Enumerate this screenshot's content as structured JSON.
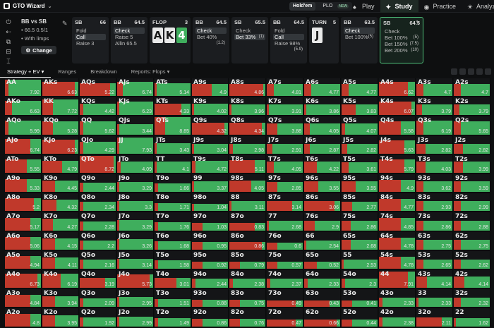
{
  "app": {
    "name": "GTO Wizard"
  },
  "mode_toggle": {
    "holdem": "Hold'em",
    "plo": "PLO",
    "new_badge": "NEW"
  },
  "nav": [
    {
      "label": "Play",
      "icon": "cards-icon"
    },
    {
      "label": "Study",
      "icon": "study-icon",
      "active": true
    },
    {
      "label": "Practice",
      "icon": "gamepad-icon"
    },
    {
      "label": "Analyze",
      "icon": "analyze-icon"
    }
  ],
  "spot": {
    "title": "BB vs SB",
    "stack": "66.5",
    "blinds": "0.5/1",
    "limps": "With limps",
    "change_label": "Change"
  },
  "action_cards": [
    {
      "pos": "SB",
      "stack": "66",
      "actions": [
        {
          "label": "Fold"
        },
        {
          "label": "Call",
          "sel": true
        },
        {
          "label": "Raise 3"
        }
      ]
    },
    {
      "pos": "BB",
      "stack": "64.5",
      "actions": [
        {
          "label": "Check",
          "sel": true
        },
        {
          "label": "Raise 5"
        },
        {
          "label": "Allin 65.5"
        }
      ]
    },
    {
      "pos": "FLOP",
      "stack": "3",
      "board": [
        "A",
        "K",
        "4"
      ]
    },
    {
      "pos": "BB",
      "stack": "64.5",
      "actions": [
        {
          "label": "Check",
          "sel": true
        },
        {
          "label": "Bet 40%",
          "n": "(1.2)"
        }
      ]
    },
    {
      "pos": "SB",
      "stack": "65.5",
      "actions": [
        {
          "label": "Check"
        },
        {
          "label": "Bet 33%",
          "n": "(1)",
          "sel": true
        }
      ]
    },
    {
      "pos": "BB",
      "stack": "64.5",
      "actions": [
        {
          "label": "Fold"
        },
        {
          "label": "Call",
          "sel": true
        },
        {
          "label": "Raise 98%",
          "n": "(5.9)"
        }
      ]
    },
    {
      "pos": "TURN",
      "stack": "5",
      "board": [
        "J"
      ]
    },
    {
      "pos": "BB",
      "stack": "63.5",
      "actions": [
        {
          "label": "Check",
          "sel": true
        },
        {
          "label": "Bet 100%",
          "n": "(5)"
        }
      ]
    },
    {
      "pos": "SB",
      "stack": "64.5",
      "active": true,
      "actions": [
        {
          "label": "Check"
        },
        {
          "label": "Bet 100%",
          "n": "(5)"
        },
        {
          "label": "Bet 150%",
          "n": "(7.5)"
        },
        {
          "label": "Bet 200%",
          "n": "(10)"
        }
      ]
    }
  ],
  "tabs": [
    "Strategy + EV",
    "Ranges",
    "Breakdown",
    "Reports: Flops"
  ],
  "colors": {
    "check": "#3fae5d",
    "bet": "#c0392b",
    "bg": "#141517"
  },
  "grid": [
    [
      [
        "AA",
        "7.92",
        0.1,
        0.9
      ],
      [
        "AKs",
        "6.63",
        0.9,
        0.1
      ],
      [
        "AQs",
        "5.22",
        0.85,
        0.15
      ],
      [
        "AJs",
        "6.74",
        0.15,
        0.85
      ],
      [
        "ATs",
        "5.14",
        0.05,
        0.95
      ],
      [
        "A9s",
        "4.9",
        0.55,
        0.45
      ],
      [
        "A8s",
        "4.86",
        0.95,
        0.05
      ],
      [
        "A7s",
        "4.81",
        0.2,
        0.8
      ],
      [
        "A6s",
        "4.77",
        0.2,
        0.8
      ],
      [
        "A5s",
        "4.77",
        0.2,
        0.8
      ],
      [
        "A4s",
        "6.62",
        0.8,
        0.2
      ],
      [
        "A3s",
        "4.7",
        0.2,
        0.8
      ],
      [
        "A2s",
        "4.7",
        0.2,
        0.8
      ]
    ],
    [
      [
        "AKo",
        "6.63",
        0.2,
        0.8
      ],
      [
        "KK",
        "7.72",
        0.3,
        0.7
      ],
      [
        "KQs",
        "4.42",
        0.1,
        0.9
      ],
      [
        "KJs",
        "6.23",
        0.05,
        0.95
      ],
      [
        "KTs",
        "4.33",
        0.75,
        0.25
      ],
      [
        "K9s",
        "4.02",
        0.05,
        0.95
      ],
      [
        "K8s",
        "3.96",
        0.05,
        0.95
      ],
      [
        "K7s",
        "3.91",
        0.05,
        0.95
      ],
      [
        "K6s",
        "3.86",
        0.05,
        0.95
      ],
      [
        "K5s",
        "3.83",
        0.4,
        0.6
      ],
      [
        "K4s",
        "6.07",
        0.9,
        0.1
      ],
      [
        "K3s",
        "3.79",
        0.15,
        0.85
      ],
      [
        "K2s",
        "3.79",
        0.15,
        0.85
      ]
    ],
    [
      [
        "AQo",
        "5.99",
        0.1,
        0.9
      ],
      [
        "KQo",
        "5.28",
        0.3,
        0.7
      ],
      [
        "QQ",
        "5.62",
        0.1,
        0.9
      ],
      [
        "QJs",
        "3.44",
        0.05,
        0.95
      ],
      [
        "QTs",
        "8.85",
        0.3,
        0.7
      ],
      [
        "Q9s",
        "4.32",
        0.9,
        0.1
      ],
      [
        "Q8s",
        "4.34",
        0.9,
        0.1
      ],
      [
        "Q7s",
        "3.88",
        0.3,
        0.7
      ],
      [
        "Q6s",
        "4.05",
        0.15,
        0.85
      ],
      [
        "Q5s",
        "4.07",
        0.1,
        0.9
      ],
      [
        "Q4s",
        "5.58",
        0.6,
        0.4
      ],
      [
        "Q3s",
        "6.19",
        0.2,
        0.8
      ],
      [
        "Q2s",
        "5.65",
        0.2,
        0.8
      ]
    ],
    [
      [
        "AJo",
        "6.74",
        0.7,
        0.3
      ],
      [
        "KJo",
        "6.23",
        0.9,
        0.1
      ],
      [
        "QJo",
        "4.29",
        0.1,
        0.9
      ],
      [
        "JJ",
        "7.93",
        0.05,
        0.95
      ],
      [
        "JTs",
        "3.43",
        0.05,
        0.95
      ],
      [
        "J9s",
        "3.04",
        0.05,
        0.95
      ],
      [
        "J8s",
        "2.98",
        0.1,
        0.9
      ],
      [
        "J7s",
        "2.91",
        0.15,
        0.85
      ],
      [
        "J6s",
        "2.87",
        0.15,
        0.85
      ],
      [
        "J5s",
        "2.82",
        0.15,
        0.85
      ],
      [
        "J4s",
        "5.63",
        0.7,
        0.3
      ],
      [
        "J3s",
        "2.82",
        0.25,
        0.75
      ],
      [
        "J2s",
        "2.82",
        0.25,
        0.75
      ]
    ],
    [
      [
        "ATo",
        "5.55",
        0.6,
        0.4
      ],
      [
        "KTo",
        "4.79",
        0.55,
        0.45
      ],
      [
        "QTo",
        "8.72",
        0.95,
        0.05
      ],
      [
        "JTo",
        "4.09",
        0.1,
        0.9
      ],
      [
        "TT",
        "4.1",
        0.05,
        0.95
      ],
      [
        "T9s",
        "4.72",
        0.1,
        0.9
      ],
      [
        "T8s",
        "5.11",
        0.7,
        0.3
      ],
      [
        "T7s",
        "4.05",
        0.2,
        0.8
      ],
      [
        "T6s",
        "4.22",
        0.35,
        0.65
      ],
      [
        "T5s",
        "3.61",
        0.2,
        0.8
      ],
      [
        "T4s",
        "5.79",
        0.7,
        0.3
      ],
      [
        "T3s",
        "4.03",
        0.25,
        0.75
      ],
      [
        "T2s",
        "3.99",
        0.25,
        0.75
      ]
    ],
    [
      [
        "A9o",
        "5.33",
        0.6,
        0.4
      ],
      [
        "K9o",
        "4.45",
        0.35,
        0.65
      ],
      [
        "Q9o",
        "2.44",
        0.1,
        0.9
      ],
      [
        "J9o",
        "3.29",
        0.05,
        0.95
      ],
      [
        "T9o",
        "1.66",
        0.1,
        0.9
      ],
      [
        "99",
        "3.37",
        0.05,
        0.95
      ],
      [
        "98s",
        "4.05",
        0.6,
        0.4
      ],
      [
        "97s",
        "2.85",
        0.3,
        0.7
      ],
      [
        "96s",
        "3.55",
        0.4,
        0.6
      ],
      [
        "95s",
        "3.55",
        0.4,
        0.6
      ],
      [
        "94s",
        "4.9",
        0.6,
        0.4
      ],
      [
        "93s",
        "3.62",
        0.2,
        0.8
      ],
      [
        "92s",
        "3.59",
        0.2,
        0.8
      ]
    ],
    [
      [
        "A8o",
        "5.2",
        0.8,
        0.2
      ],
      [
        "K8o",
        "4.32",
        0.4,
        0.6
      ],
      [
        "Q8o",
        "2.34",
        0.1,
        0.9
      ],
      [
        "J8o",
        "3.3",
        0.05,
        0.95
      ],
      [
        "T8o",
        "1.71",
        0.1,
        0.9
      ],
      [
        "98o",
        "1.04",
        0.05,
        0.95
      ],
      [
        "88",
        "3.11",
        0.05,
        0.95
      ],
      [
        "87s",
        "3.14",
        0.7,
        0.3
      ],
      [
        "86s",
        "3.06",
        0.85,
        0.15
      ],
      [
        "85s",
        "2.77",
        0.3,
        0.7
      ],
      [
        "84s",
        "4.77",
        0.6,
        0.4
      ],
      [
        "83s",
        "2.93",
        0.2,
        0.8
      ],
      [
        "82s",
        "2.99",
        0.2,
        0.8
      ]
    ],
    [
      [
        "A7o",
        "5.17",
        0.7,
        0.3
      ],
      [
        "K7o",
        "4.27",
        0.3,
        0.7
      ],
      [
        "Q7o",
        "2.28",
        0.1,
        0.9
      ],
      [
        "J7o",
        "3.29",
        0.05,
        0.95
      ],
      [
        "T7o",
        "1.76",
        0.1,
        0.9
      ],
      [
        "97o",
        "1.03",
        0.3,
        0.7
      ],
      [
        "87o",
        "0.83",
        0.7,
        0.3
      ],
      [
        "77",
        "2.68",
        0.05,
        0.95
      ],
      [
        "76s",
        "2.9",
        0.3,
        0.7
      ],
      [
        "75s",
        "2.86",
        0.25,
        0.75
      ],
      [
        "74s",
        "4.85",
        0.6,
        0.4
      ],
      [
        "73s",
        "2.86",
        0.2,
        0.8
      ],
      [
        "72s",
        "2.88",
        0.2,
        0.8
      ]
    ],
    [
      [
        "A6o",
        "5.06",
        0.7,
        0.3
      ],
      [
        "K6o",
        "4.15",
        0.35,
        0.65
      ],
      [
        "Q6o",
        "2.2",
        0.1,
        0.9
      ],
      [
        "J6o",
        "3.26",
        0.05,
        0.95
      ],
      [
        "T6o",
        "1.68",
        0.1,
        0.9
      ],
      [
        "96o",
        "0.95",
        0.3,
        0.7
      ],
      [
        "86o",
        "0.86",
        0.9,
        0.1
      ],
      [
        "76o",
        "0.6",
        0.3,
        0.7
      ],
      [
        "66",
        "2.54",
        0.05,
        0.95
      ],
      [
        "65s",
        "2.68",
        0.25,
        0.75
      ],
      [
        "64s",
        "4.78",
        0.6,
        0.4
      ],
      [
        "63s",
        "2.75",
        0.2,
        0.8
      ],
      [
        "62s",
        "2.75",
        0.2,
        0.8
      ]
    ],
    [
      [
        "A5o",
        "4.94",
        0.7,
        0.3
      ],
      [
        "K5o",
        "4.11",
        0.35,
        0.65
      ],
      [
        "Q5o",
        "2.16",
        0.1,
        0.9
      ],
      [
        "J5o",
        "3.14",
        0.05,
        0.95
      ],
      [
        "T5o",
        "1.58",
        0.1,
        0.9
      ],
      [
        "95o",
        "0.92",
        0.3,
        0.7
      ],
      [
        "85o",
        "0.79",
        0.3,
        0.7
      ],
      [
        "75o",
        "0.57",
        0.3,
        0.7
      ],
      [
        "65o",
        "0.52",
        0.35,
        0.65
      ],
      [
        "55",
        "2.53",
        0.05,
        0.95
      ],
      [
        "54s",
        "4.78",
        0.6,
        0.4
      ],
      [
        "53s",
        "2.65",
        0.2,
        0.8
      ],
      [
        "52s",
        "2.62",
        0.2,
        0.8
      ]
    ],
    [
      [
        "A4o",
        "6.73",
        0.9,
        0.1
      ],
      [
        "K4o",
        "6.19",
        0.5,
        0.5
      ],
      [
        "Q4o",
        "3.19",
        0.7,
        0.3
      ],
      [
        "J4o",
        "5.73",
        0.9,
        0.1
      ],
      [
        "T4o",
        "3.01",
        0.6,
        0.4
      ],
      [
        "94o",
        "2.44",
        0.1,
        0.9
      ],
      [
        "84o",
        "2.38",
        0.1,
        0.9
      ],
      [
        "74o",
        "2.37",
        0.1,
        0.9
      ],
      [
        "64o",
        "2.33",
        0.1,
        0.9
      ],
      [
        "54o",
        "2.3",
        0.1,
        0.9
      ],
      [
        "44",
        "7.91",
        0.8,
        0.2
      ],
      [
        "43s",
        "4.14",
        0.3,
        0.7
      ],
      [
        "42s",
        "4.14",
        0.3,
        0.7
      ]
    ],
    [
      [
        "A3o",
        "4.84",
        0.7,
        0.3
      ],
      [
        "K3o",
        "3.94",
        0.35,
        0.65
      ],
      [
        "Q3o",
        "2.09",
        0.1,
        0.9
      ],
      [
        "J3o",
        "2.95",
        0.05,
        0.95
      ],
      [
        "T3o",
        "1.51",
        0.1,
        0.9
      ],
      [
        "93o",
        "0.88",
        0.3,
        0.7
      ],
      [
        "83o",
        "0.75",
        0.3,
        0.7
      ],
      [
        "73o",
        "0.49",
        0.8,
        0.2
      ],
      [
        "63o",
        "0.43",
        0.7,
        0.3
      ],
      [
        "53o",
        "0.41",
        0.3,
        0.7
      ],
      [
        "43o",
        "2.33",
        0.1,
        0.9
      ],
      [
        "33",
        "2.33",
        0.05,
        0.95
      ],
      [
        "32s",
        "2.32",
        0.2,
        0.8
      ]
    ],
    [
      [
        "A2o",
        "4.8",
        0.7,
        0.3
      ],
      [
        "K2o",
        "3.95",
        0.35,
        0.65
      ],
      [
        "Q2o",
        "1.92",
        0.1,
        0.9
      ],
      [
        "J2o",
        "2.99",
        0.05,
        0.95
      ],
      [
        "T2o",
        "1.49",
        0.1,
        0.9
      ],
      [
        "92o",
        "0.86",
        0.3,
        0.7
      ],
      [
        "82o",
        "0.76",
        0.3,
        0.7
      ],
      [
        "72o",
        "0.47",
        0.8,
        0.2
      ],
      [
        "62o",
        "0.66",
        0.9,
        0.1
      ],
      [
        "52o",
        "0.44",
        0.3,
        0.7
      ],
      [
        "42o",
        "2.38",
        0.1,
        0.9
      ],
      [
        "32o",
        "2.11",
        0.7,
        0.3
      ],
      [
        "22",
        "1.62",
        0.05,
        0.95
      ]
    ]
  ]
}
